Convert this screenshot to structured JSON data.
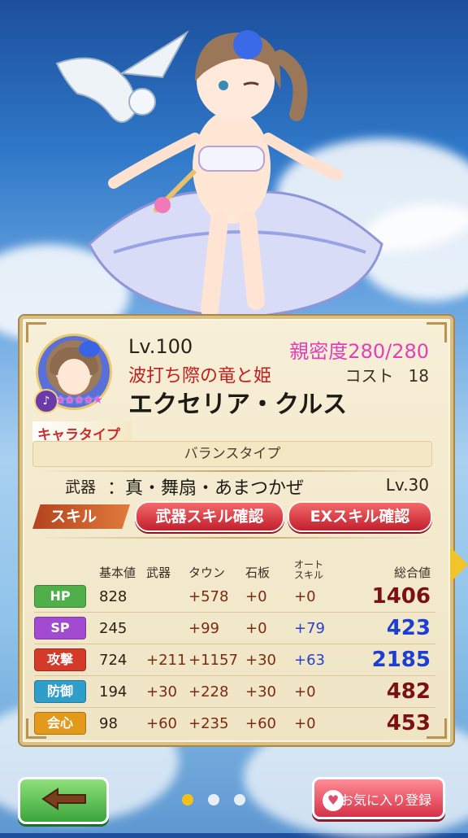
{
  "character": {
    "level": "Lv.100",
    "affinity_label": "親密度",
    "affinity_value": "280/280",
    "title": "波打ち際の竜と姫",
    "cost_label": "コスト",
    "cost_value": "18",
    "name": "エクセリア・クルス",
    "rarity_stars": "★★★★★",
    "weapon_badge_icon": "fan-weapon-icon"
  },
  "type": {
    "label": "キャラタイプ",
    "value": "バランスタイプ"
  },
  "weapon": {
    "label": "武器",
    "name": "：真・舞扇・あまつかぜ",
    "level": "Lv.30"
  },
  "skills": {
    "label": "スキル",
    "weapon_skill_button": "武器スキル確認",
    "ex_skill_button": "EXスキル確認"
  },
  "stats": {
    "headers": {
      "base": "基本値",
      "weapon": "武器",
      "town": "タウン",
      "stone": "石板",
      "auto_line1": "オート",
      "auto_line2": "スキル",
      "total": "総合値"
    },
    "rows": [
      {
        "label": "HP",
        "color": "#4fb04a",
        "base": "828",
        "weapon": "",
        "town": "+578",
        "stone": "+0",
        "auto": "+0",
        "total": "1406",
        "auto_blue": false,
        "total_blue": false
      },
      {
        "label": "SP",
        "color": "#a24bd0",
        "base": "245",
        "weapon": "",
        "town": "+99",
        "stone": "+0",
        "auto": "+79",
        "total": "423",
        "auto_blue": true,
        "total_blue": true
      },
      {
        "label": "攻撃",
        "color": "#d43a2a",
        "base": "724",
        "weapon": "+211",
        "town": "+1157",
        "stone": "+30",
        "auto": "+63",
        "total": "2185",
        "auto_blue": true,
        "total_blue": true
      },
      {
        "label": "防御",
        "color": "#2f9ec9",
        "base": "194",
        "weapon": "+30",
        "town": "+228",
        "stone": "+30",
        "auto": "+0",
        "total": "482",
        "auto_blue": false,
        "total_blue": false
      },
      {
        "label": "会心",
        "color": "#e39a1c",
        "base": "98",
        "weapon": "+60",
        "town": "+235",
        "stone": "+60",
        "auto": "+0",
        "total": "453",
        "auto_blue": false,
        "total_blue": false
      }
    ]
  },
  "footer": {
    "back_icon": "left-arrow-icon",
    "favorite_label": "お気に入り登録",
    "favorite_icon": "heart-lock-icon",
    "page_dots": [
      true,
      false,
      false
    ]
  }
}
